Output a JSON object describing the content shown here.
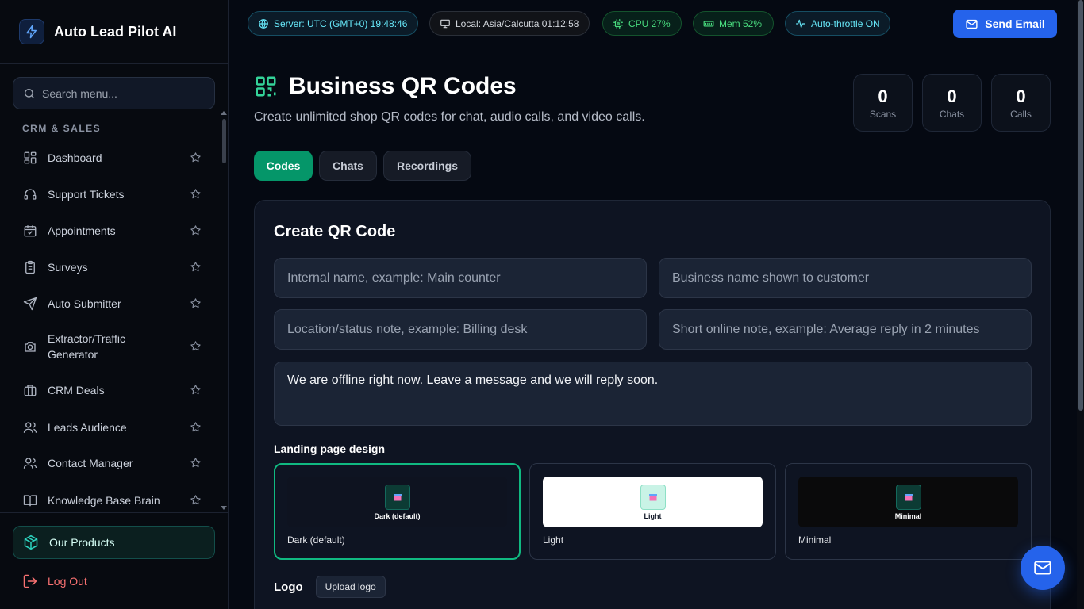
{
  "brand": {
    "title": "Auto Lead Pilot AI"
  },
  "search": {
    "placeholder": "Search menu..."
  },
  "sidebar": {
    "section_label": "CRM & SALES",
    "items": [
      {
        "label": "Dashboard",
        "icon": "dashboard-icon"
      },
      {
        "label": "Support Tickets",
        "icon": "headset-icon"
      },
      {
        "label": "Appointments",
        "icon": "calendar-check-icon"
      },
      {
        "label": "Surveys",
        "icon": "clipboard-icon"
      },
      {
        "label": "Auto Submitter",
        "icon": "send-icon"
      },
      {
        "label": "Extractor/Traffic Generator",
        "icon": "camera-icon"
      },
      {
        "label": "CRM Deals",
        "icon": "briefcase-icon"
      },
      {
        "label": "Leads Audience",
        "icon": "users-icon"
      },
      {
        "label": "Contact Manager",
        "icon": "user-group-icon"
      },
      {
        "label": "Knowledge Base Brain",
        "icon": "book-icon"
      }
    ],
    "products_label": "Our Products",
    "logout_label": "Log Out"
  },
  "topbar": {
    "server": "Server: UTC (GMT+0) 19:48:46",
    "local": "Local: Asia/Calcutta 01:12:58",
    "cpu": "CPU 27%",
    "mem": "Mem 52%",
    "throttle": "Auto-throttle ON",
    "send_email": "Send Email"
  },
  "page": {
    "title": "Business QR Codes",
    "subtitle": "Create unlimited shop QR codes for chat, audio calls, and video calls."
  },
  "stats": [
    {
      "value": "0",
      "label": "Scans"
    },
    {
      "value": "0",
      "label": "Chats"
    },
    {
      "value": "0",
      "label": "Calls"
    }
  ],
  "tabs": [
    {
      "label": "Codes",
      "active": true
    },
    {
      "label": "Chats",
      "active": false
    },
    {
      "label": "Recordings",
      "active": false
    }
  ],
  "form": {
    "title": "Create QR Code",
    "internal_name_placeholder": "Internal name, example: Main counter",
    "business_name_placeholder": "Business name shown to customer",
    "location_placeholder": "Location/status note, example: Billing desk",
    "online_note_placeholder": "Short online note, example: Average reply in 2 minutes",
    "offline_message": "We are offline right now. Leave a message and we will reply soon.",
    "design_label": "Landing page design",
    "designs": [
      {
        "preview_name": "Dark (default)",
        "label": "Dark (default)",
        "selected": true
      },
      {
        "preview_name": "Light",
        "label": "Light",
        "selected": false
      },
      {
        "preview_name": "Minimal",
        "label": "Minimal",
        "selected": false
      }
    ],
    "logo_label": "Logo",
    "upload_logo": "Upload logo"
  },
  "colors": {
    "accent_green": "#059669",
    "accent_blue": "#2563eb",
    "danger": "#f87171"
  }
}
